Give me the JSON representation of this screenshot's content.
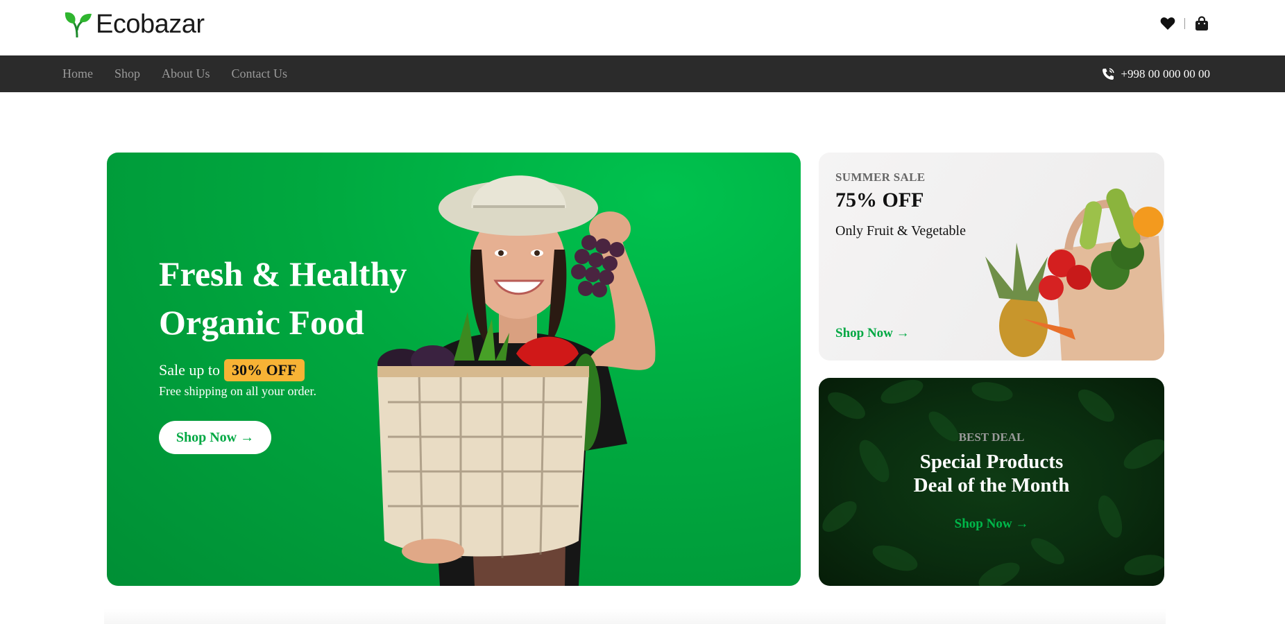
{
  "brand": {
    "name": "Ecobazar"
  },
  "header": {
    "icons": [
      "heart-icon",
      "shopping-bag-icon"
    ]
  },
  "nav": {
    "items": [
      {
        "label": "Home"
      },
      {
        "label": "Shop"
      },
      {
        "label": "About Us"
      },
      {
        "label": "Contact Us"
      }
    ],
    "phone": "+998 00 000 00 00"
  },
  "hero": {
    "title": "Fresh & Healthy Organic Food",
    "sale_prefix": "Sale up to",
    "sale_badge": "30% OFF",
    "shipping": "Free shipping on all your order.",
    "cta": "Shop Now →"
  },
  "summer_card": {
    "eyebrow": "SUMMER SALE",
    "headline": "75% OFF",
    "subtitle": "Only Fruit & Vegetable",
    "cta": "Shop Now →"
  },
  "deal_card": {
    "eyebrow": "BEST DEAL",
    "title_line1": "Special Products",
    "title_line2": "Deal of the Month",
    "cta": "Shop Now →"
  },
  "colors": {
    "brand_green": "#00b74a",
    "nav_bg": "#2b2b2b",
    "badge": "#f7b335",
    "deal_bg": "#0a2d0f"
  }
}
